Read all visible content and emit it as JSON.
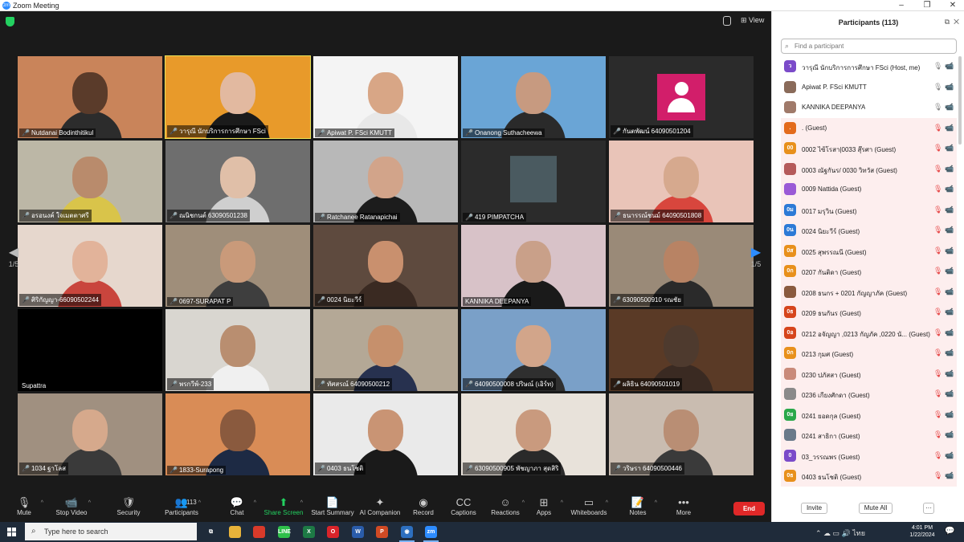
{
  "window": {
    "title": "Zoom Meeting",
    "minimize": "–",
    "maximize": "❐",
    "close": "✕"
  },
  "top": {
    "view_label": "View"
  },
  "tiles": [
    {
      "name": "Nutdanai Bodinthitikul",
      "kind": "video",
      "bg": "#c9845a",
      "skin": "#5a3b2a",
      "shirt": "#2c2c2c"
    },
    {
      "name": "วารุณี นักบริการการศึกษา FSci",
      "kind": "video",
      "bg": "#e89a2a",
      "skin": "#e2b9a0",
      "shirt": "#1b1b1b",
      "active": true
    },
    {
      "name": "Apiwat P. FSci KMUTT",
      "kind": "video",
      "bg": "#f4f4f4",
      "skin": "#d8a686",
      "shirt": "#e8e8e8"
    },
    {
      "name": "Onanong Suthacheewa",
      "kind": "video",
      "bg": "#6aa5d6",
      "skin": "#c79a80",
      "shirt": "#2a2a2a"
    },
    {
      "name": "กันตพัฒน์ 64090501204",
      "kind": "avatar"
    },
    {
      "name": "อรอนงค์ ใจเมตตาศรี",
      "kind": "video",
      "bg": "#bcb7a6",
      "skin": "#b98b6c",
      "shirt": "#d9c44a"
    },
    {
      "name": "ณนิชกนต์ 63090501238",
      "kind": "video",
      "bg": "#6e6e6e",
      "skin": "#e0bfa8",
      "shirt": "#cfcfcf"
    },
    {
      "name": "Ratchanee Ratanapichai",
      "kind": "video",
      "bg": "#b8b8b8",
      "skin": "#d2a48a",
      "shirt": "#1c1c1c"
    },
    {
      "name": "419 PIMPATCHA",
      "kind": "cartoon"
    },
    {
      "name": "ธนารรณ์ชนม์ 64090501808",
      "kind": "video",
      "bg": "#e9c4b8",
      "skin": "#d6a98e",
      "shirt": "#d8463d"
    },
    {
      "name": "ศิริกัญญา-66090502244",
      "kind": "video",
      "bg": "#e6d7cd",
      "skin": "#e2b39a",
      "shirt": "#c9453d"
    },
    {
      "name": "0697-SURAPAT P",
      "kind": "video",
      "bg": "#9f8e7a",
      "skin": "#c99a7a",
      "shirt": "#3e3e3e"
    },
    {
      "name": "0024 นิยะวีร์",
      "kind": "video",
      "bg": "#5e4a3e",
      "skin": "#c9906e",
      "shirt": "#3a2a22"
    },
    {
      "name": "KANNIKA DEEPANYA",
      "kind": "video",
      "bg": "#d8c2c8",
      "skin": "#c9a089",
      "shirt": "#1a1a1a"
    },
    {
      "name": "63090500910 รณชัย",
      "kind": "video",
      "bg": "#9a8a78",
      "skin": "#b88364",
      "shirt": "#2a2a2a"
    },
    {
      "name": "Supattra",
      "kind": "blank"
    },
    {
      "name": "พรกวีพ์-233",
      "kind": "video",
      "bg": "#d9d6d0",
      "skin": "#b98e70",
      "shirt": "#f0f0f0"
    },
    {
      "name": "ทัศสรณ์ 64090500212",
      "kind": "video",
      "bg": "#b4a896",
      "skin": "#c6906c",
      "shirt": "#27314f"
    },
    {
      "name": "64090500008 ปริษณ์ (เอิร์ท)",
      "kind": "video",
      "bg": "#7aa0c8",
      "skin": "#d2a58a",
      "shirt": "#2f2f2f"
    },
    {
      "name": "ผลิธิน 64090501019",
      "kind": "video",
      "bg": "#5a3a26",
      "skin": "#4e3a2e",
      "shirt": "#3a2a22"
    },
    {
      "name": "1034 ฐาโลส",
      "kind": "video",
      "bg": "#a09080",
      "skin": "#d6a98c",
      "shirt": "#3a3a3a"
    },
    {
      "name": "1833-Surapong",
      "kind": "video",
      "bg": "#d98c56",
      "skin": "#8a5a3e",
      "shirt": "#1d2a44"
    },
    {
      "name": "0403 ธนโชติ",
      "kind": "video",
      "bg": "#eaeaea",
      "skin": "#c99474",
      "shirt": "#1a1a1a"
    },
    {
      "name": "63090500905 พัชญาภา สุดสิริ",
      "kind": "video",
      "bg": "#e8e2da",
      "skin": "#c99a7e",
      "shirt": "#2a2a2a"
    },
    {
      "name": "วริษรา 64090500446",
      "kind": "video",
      "bg": "#c9bcb0",
      "skin": "#b98e74",
      "shirt": "#3a3a3a"
    }
  ],
  "nav": {
    "left_page": "1/5",
    "right_page": "1/5",
    "left_arrow": "◀",
    "right_arrow": "▶"
  },
  "toolbar": {
    "items": [
      {
        "key": "mute",
        "label": "Mute",
        "icon": "🎙",
        "caret": true
      },
      {
        "key": "stop-video",
        "label": "Stop Video",
        "icon": "📹",
        "caret": true
      },
      {
        "key": "security",
        "label": "Security",
        "icon": "🛡"
      },
      {
        "key": "participants",
        "label": "Participants",
        "icon": "👥",
        "caret": true,
        "badge": "113"
      },
      {
        "key": "chat",
        "label": "Chat",
        "icon": "💬",
        "caret": true
      },
      {
        "key": "share-screen",
        "label": "Share Screen",
        "icon": "⬆",
        "caret": true,
        "green": true
      },
      {
        "key": "start-summary",
        "label": "Start Summary",
        "icon": "📄"
      },
      {
        "key": "ai-companion",
        "label": "AI Companion",
        "icon": "✦"
      },
      {
        "key": "record",
        "label": "Record",
        "icon": "◉"
      },
      {
        "key": "captions",
        "label": "Captions",
        "icon": "CC"
      },
      {
        "key": "reactions",
        "label": "Reactions",
        "icon": "☺",
        "caret": true
      },
      {
        "key": "apps",
        "label": "Apps",
        "icon": "⊞",
        "caret": true
      },
      {
        "key": "whiteboards",
        "label": "Whiteboards",
        "icon": "▭",
        "caret": true
      },
      {
        "key": "notes",
        "label": "Notes",
        "icon": "📝",
        "caret": true
      },
      {
        "key": "more",
        "label": "More",
        "icon": "•••"
      }
    ],
    "end_label": "End"
  },
  "panel": {
    "title": "Participants (113)",
    "search_placeholder": "Find a participant",
    "participants": [
      {
        "name": "วารุณี นักบริการการศึกษา FSci (Host, me)",
        "avatar": "ว",
        "color": "#7b4bc9",
        "guest": false
      },
      {
        "name": "Apiwat P. FSci KMUTT",
        "avatar": "",
        "color": "#8a6b5a",
        "guest": false
      },
      {
        "name": "KANNIKA DEEPANYA",
        "avatar": "",
        "color": "#a07a6a",
        "guest": false
      },
      {
        "name": ". (Guest)",
        "avatar": ".",
        "color": "#e36b1c",
        "guest": true
      },
      {
        "name": "0002 ไซ้โรสา|0033 สุ๊รศา (Guest)",
        "avatar": "00",
        "color": "#e8901c",
        "guest": true
      },
      {
        "name": "0003 ณัฐกันร/ 0030 วิทวัส (Guest)",
        "avatar": "",
        "color": "#b55a5a",
        "guest": true
      },
      {
        "name": "0009 Nattida (Guest)",
        "avatar": "",
        "color": "#9a5ad6",
        "guest": true
      },
      {
        "name": "0017 มรุวิน (Guest)",
        "avatar": "0ม",
        "color": "#2d7ad6",
        "guest": true
      },
      {
        "name": "0024 นิยะวีร์ (Guest)",
        "avatar": "0น",
        "color": "#2d7ad6",
        "guest": true
      },
      {
        "name": "0025 สุพรรณนี (Guest)",
        "avatar": "0ส",
        "color": "#e8901c",
        "guest": true
      },
      {
        "name": "0207 กันติดา (Guest)",
        "avatar": "0ก",
        "color": "#e8901c",
        "guest": true
      },
      {
        "name": "0208 ธนกร + 0201 กัญญาภัค (Guest)",
        "avatar": "",
        "color": "#8a5a3e",
        "guest": true
      },
      {
        "name": "0209 ธนกันร (Guest)",
        "avatar": "0ธ",
        "color": "#d6451c",
        "guest": true
      },
      {
        "name": "0212 อจัญญา ,0213 กัญภัค ,0220 นั... (Guest)",
        "avatar": "0อ",
        "color": "#d6451c",
        "guest": true
      },
      {
        "name": "0213 กุมศ (Guest)",
        "avatar": "0ก",
        "color": "#e8901c",
        "guest": true
      },
      {
        "name": "0230 ปภัสสา (Guest)",
        "avatar": "",
        "color": "#c98a7a",
        "guest": true
      },
      {
        "name": "0236 เกียงศักดา (Guest)",
        "avatar": "",
        "color": "#8a8a8a",
        "guest": true
      },
      {
        "name": "0241 ยอดกุล (Guest)",
        "avatar": "0ย",
        "color": "#2aa84a",
        "guest": true
      },
      {
        "name": "0241 สาธิกา (Guest)",
        "avatar": "",
        "color": "#6a7a8a",
        "guest": true
      },
      {
        "name": "03_วรรณพร (Guest)",
        "avatar": "0",
        "color": "#7b4bc9",
        "guest": true
      },
      {
        "name": "0403 ธนโชติ (Guest)",
        "avatar": "0ธ",
        "color": "#e8901c",
        "guest": true
      }
    ],
    "invite_label": "Invite",
    "mute_all_label": "Mute All",
    "more_label": "···"
  },
  "taskbar": {
    "search_placeholder": "Type here to search",
    "apps": [
      {
        "key": "task-view",
        "icon": "⧉",
        "color": "transparent"
      },
      {
        "key": "file-explorer",
        "icon": "",
        "color": "#e8b33a"
      },
      {
        "key": "chrome",
        "icon": "",
        "color": "#d93a2a"
      },
      {
        "key": "line",
        "icon": "LINE",
        "color": "#2ec04a"
      },
      {
        "key": "excel",
        "icon": "X",
        "color": "#1d7a45"
      },
      {
        "key": "opera",
        "icon": "O",
        "color": "#d9242a"
      },
      {
        "key": "word",
        "icon": "W",
        "color": "#2a5caa"
      },
      {
        "key": "powerpoint",
        "icon": "P",
        "color": "#d04a24"
      },
      {
        "key": "camera",
        "icon": "◉",
        "color": "#2d6fbf"
      },
      {
        "key": "zoom",
        "icon": "zm",
        "color": "#2d8cff"
      }
    ],
    "tray": "⌃ ☁ ▭ 🔊 ไทย",
    "time": "4:01 PM",
    "date": "1/22/2024",
    "notification": "💬"
  },
  "colors": {
    "accent": "#2d8cff",
    "end": "#e02828",
    "active_border": "#e8e35a",
    "guest_row": "#fdeeee"
  }
}
